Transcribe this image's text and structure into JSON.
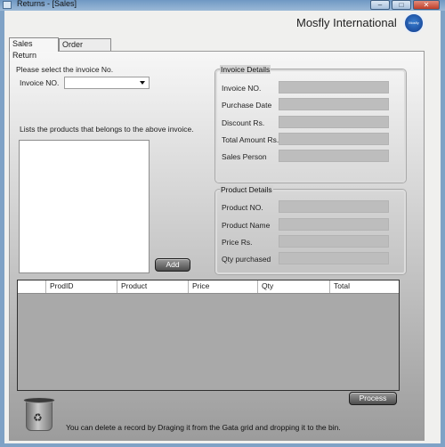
{
  "window": {
    "title": "Returns - [Sales]",
    "minimize_glyph": "–",
    "maximize_glyph": "□",
    "close_glyph": "✕"
  },
  "header": {
    "company": "Mosfly International",
    "logo_text": "Mosfly"
  },
  "tabs": [
    {
      "label": "Sales Return",
      "active": true
    },
    {
      "label": "Order Returns",
      "active": false
    }
  ],
  "invoice_select": {
    "prompt": "Please select the invoice No.",
    "label": "Invoice NO.",
    "value": ""
  },
  "products_list": {
    "caption": "Lists the products that  belongs to the above invoice."
  },
  "invoice_details": {
    "title": "Invoice Details",
    "fields": [
      {
        "label": "Invoice NO.",
        "value": ""
      },
      {
        "label": "Purchase Date",
        "value": ""
      },
      {
        "label": "Discount Rs.",
        "value": ""
      },
      {
        "label": "Total Amount Rs.",
        "value": ""
      },
      {
        "label": "Sales Person",
        "value": ""
      }
    ]
  },
  "product_details": {
    "title": "Product Details",
    "fields": [
      {
        "label": "Product NO.",
        "value": ""
      },
      {
        "label": "Product Name",
        "value": ""
      },
      {
        "label": "Price  Rs.",
        "value": ""
      },
      {
        "label": "Qty purchased",
        "value": ""
      }
    ]
  },
  "buttons": {
    "add": "Add",
    "process": "Process"
  },
  "grid": {
    "columns": [
      "ProdID",
      "Product",
      "Price",
      "Qty",
      "Total"
    ]
  },
  "footer": {
    "hint": "You can delete a record by Draging it from the Gata grid and dropping it to the bin.",
    "bin_icon": "recycle-bin-icon",
    "bin_glyph": "♻"
  }
}
